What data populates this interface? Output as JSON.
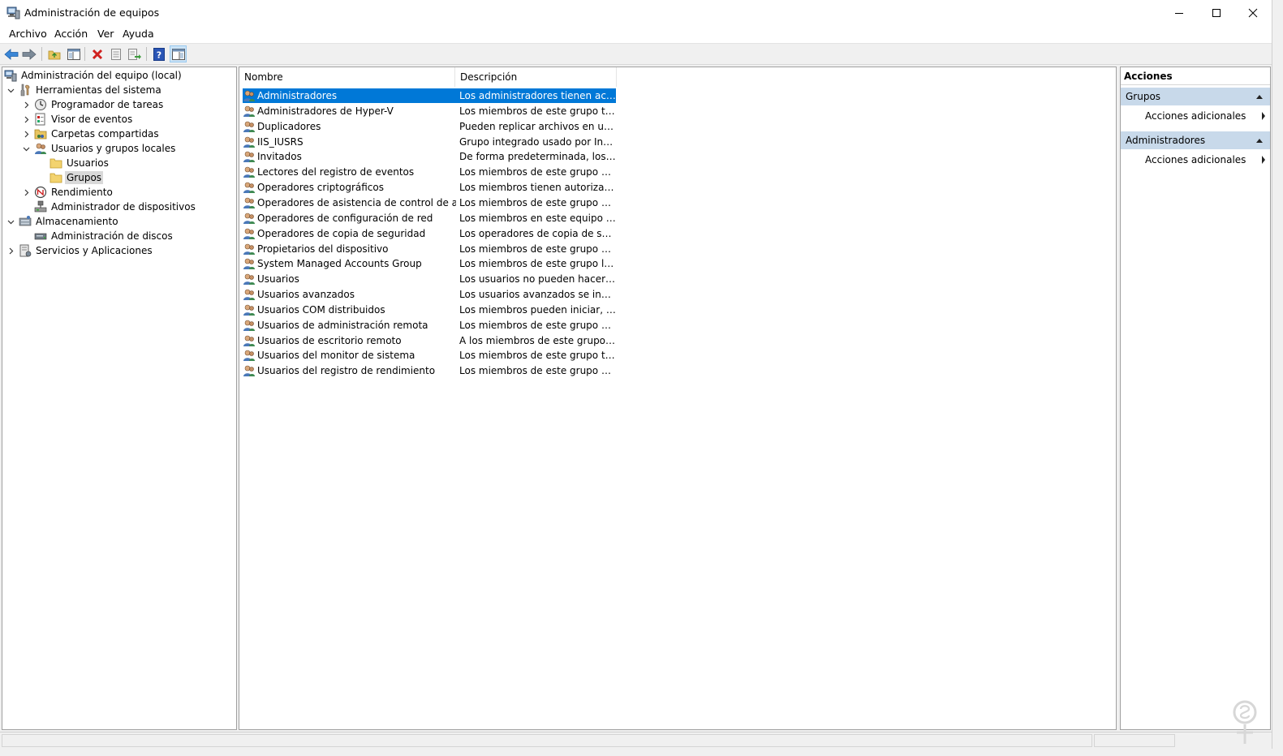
{
  "window": {
    "title": "Administración de equipos"
  },
  "menu": [
    "Archivo",
    "Acción",
    "Ver",
    "Ayuda"
  ],
  "toolbar": {
    "icons": [
      "back-icon",
      "forward-icon",
      "up-folder-icon",
      "show-hide-tree-icon",
      "delete-icon",
      "properties-icon",
      "export-list-icon",
      "help-icon",
      "show-hide-action-pane-icon"
    ]
  },
  "tree": {
    "root": "Administración del equipo (local)",
    "system_tools": "Herramientas del sistema",
    "task_scheduler": "Programador de tareas",
    "event_viewer": "Visor de eventos",
    "shared_folders": "Carpetas compartidas",
    "local_users_groups": "Usuarios y grupos locales",
    "users": "Usuarios",
    "groups": "Grupos",
    "performance": "Rendimiento",
    "device_manager": "Administrador de dispositivos",
    "storage": "Almacenamiento",
    "disk_management": "Administración de discos",
    "services_apps": "Servicios y Aplicaciones"
  },
  "list": {
    "columns": [
      "Nombre",
      "Descripción"
    ],
    "rows": [
      {
        "name": "Administradores",
        "desc": "Los administradores tienen acces...",
        "selected": true
      },
      {
        "name": "Administradores de Hyper-V",
        "desc": "Los miembros de este grupo tiene..."
      },
      {
        "name": "Duplicadores",
        "desc": "Pueden replicar archivos en un do..."
      },
      {
        "name": "IIS_IUSRS",
        "desc": "Grupo integrado usado por Intern..."
      },
      {
        "name": "Invitados",
        "desc": "De forma predeterminada, los invi..."
      },
      {
        "name": "Lectores del registro de eventos",
        "desc": "Los miembros de este grupo pue..."
      },
      {
        "name": "Operadores criptográficos",
        "desc": "Los miembros tienen autorización..."
      },
      {
        "name": "Operadores de asistencia de control de acceso",
        "desc": "Los miembros de este grupo pue..."
      },
      {
        "name": "Operadores de configuración de red",
        "desc": "Los miembros en este equipo pue..."
      },
      {
        "name": "Operadores de copia de seguridad",
        "desc": "Los operadores de copia de seguri..."
      },
      {
        "name": "Propietarios del dispositivo",
        "desc": "Los miembros de este grupo pue..."
      },
      {
        "name": "System Managed Accounts Group",
        "desc": "Los miembros de este grupo los a..."
      },
      {
        "name": "Usuarios",
        "desc": "Los usuarios no pueden hacer ca..."
      },
      {
        "name": "Usuarios avanzados",
        "desc": "Los usuarios avanzados se incluye..."
      },
      {
        "name": "Usuarios COM distribuidos",
        "desc": "Los miembros pueden iniciar, acti..."
      },
      {
        "name": "Usuarios de administración remota",
        "desc": "Los miembros de este grupo pue..."
      },
      {
        "name": "Usuarios de escritorio remoto",
        "desc": "A los miembros de este grupo se l..."
      },
      {
        "name": "Usuarios del monitor de sistema",
        "desc": "Los miembros de este grupo tiene..."
      },
      {
        "name": "Usuarios del registro de rendimiento",
        "desc": "Los miembros de este grupo pue..."
      }
    ]
  },
  "actions": {
    "title": "Acciones",
    "section1": "Grupos",
    "section1_item": "Acciones adicionales",
    "section2": "Administradores",
    "section2_item": "Acciones adicionales"
  },
  "colors": {
    "selection": "#0078d7",
    "section_header": "#c8d9ea"
  }
}
